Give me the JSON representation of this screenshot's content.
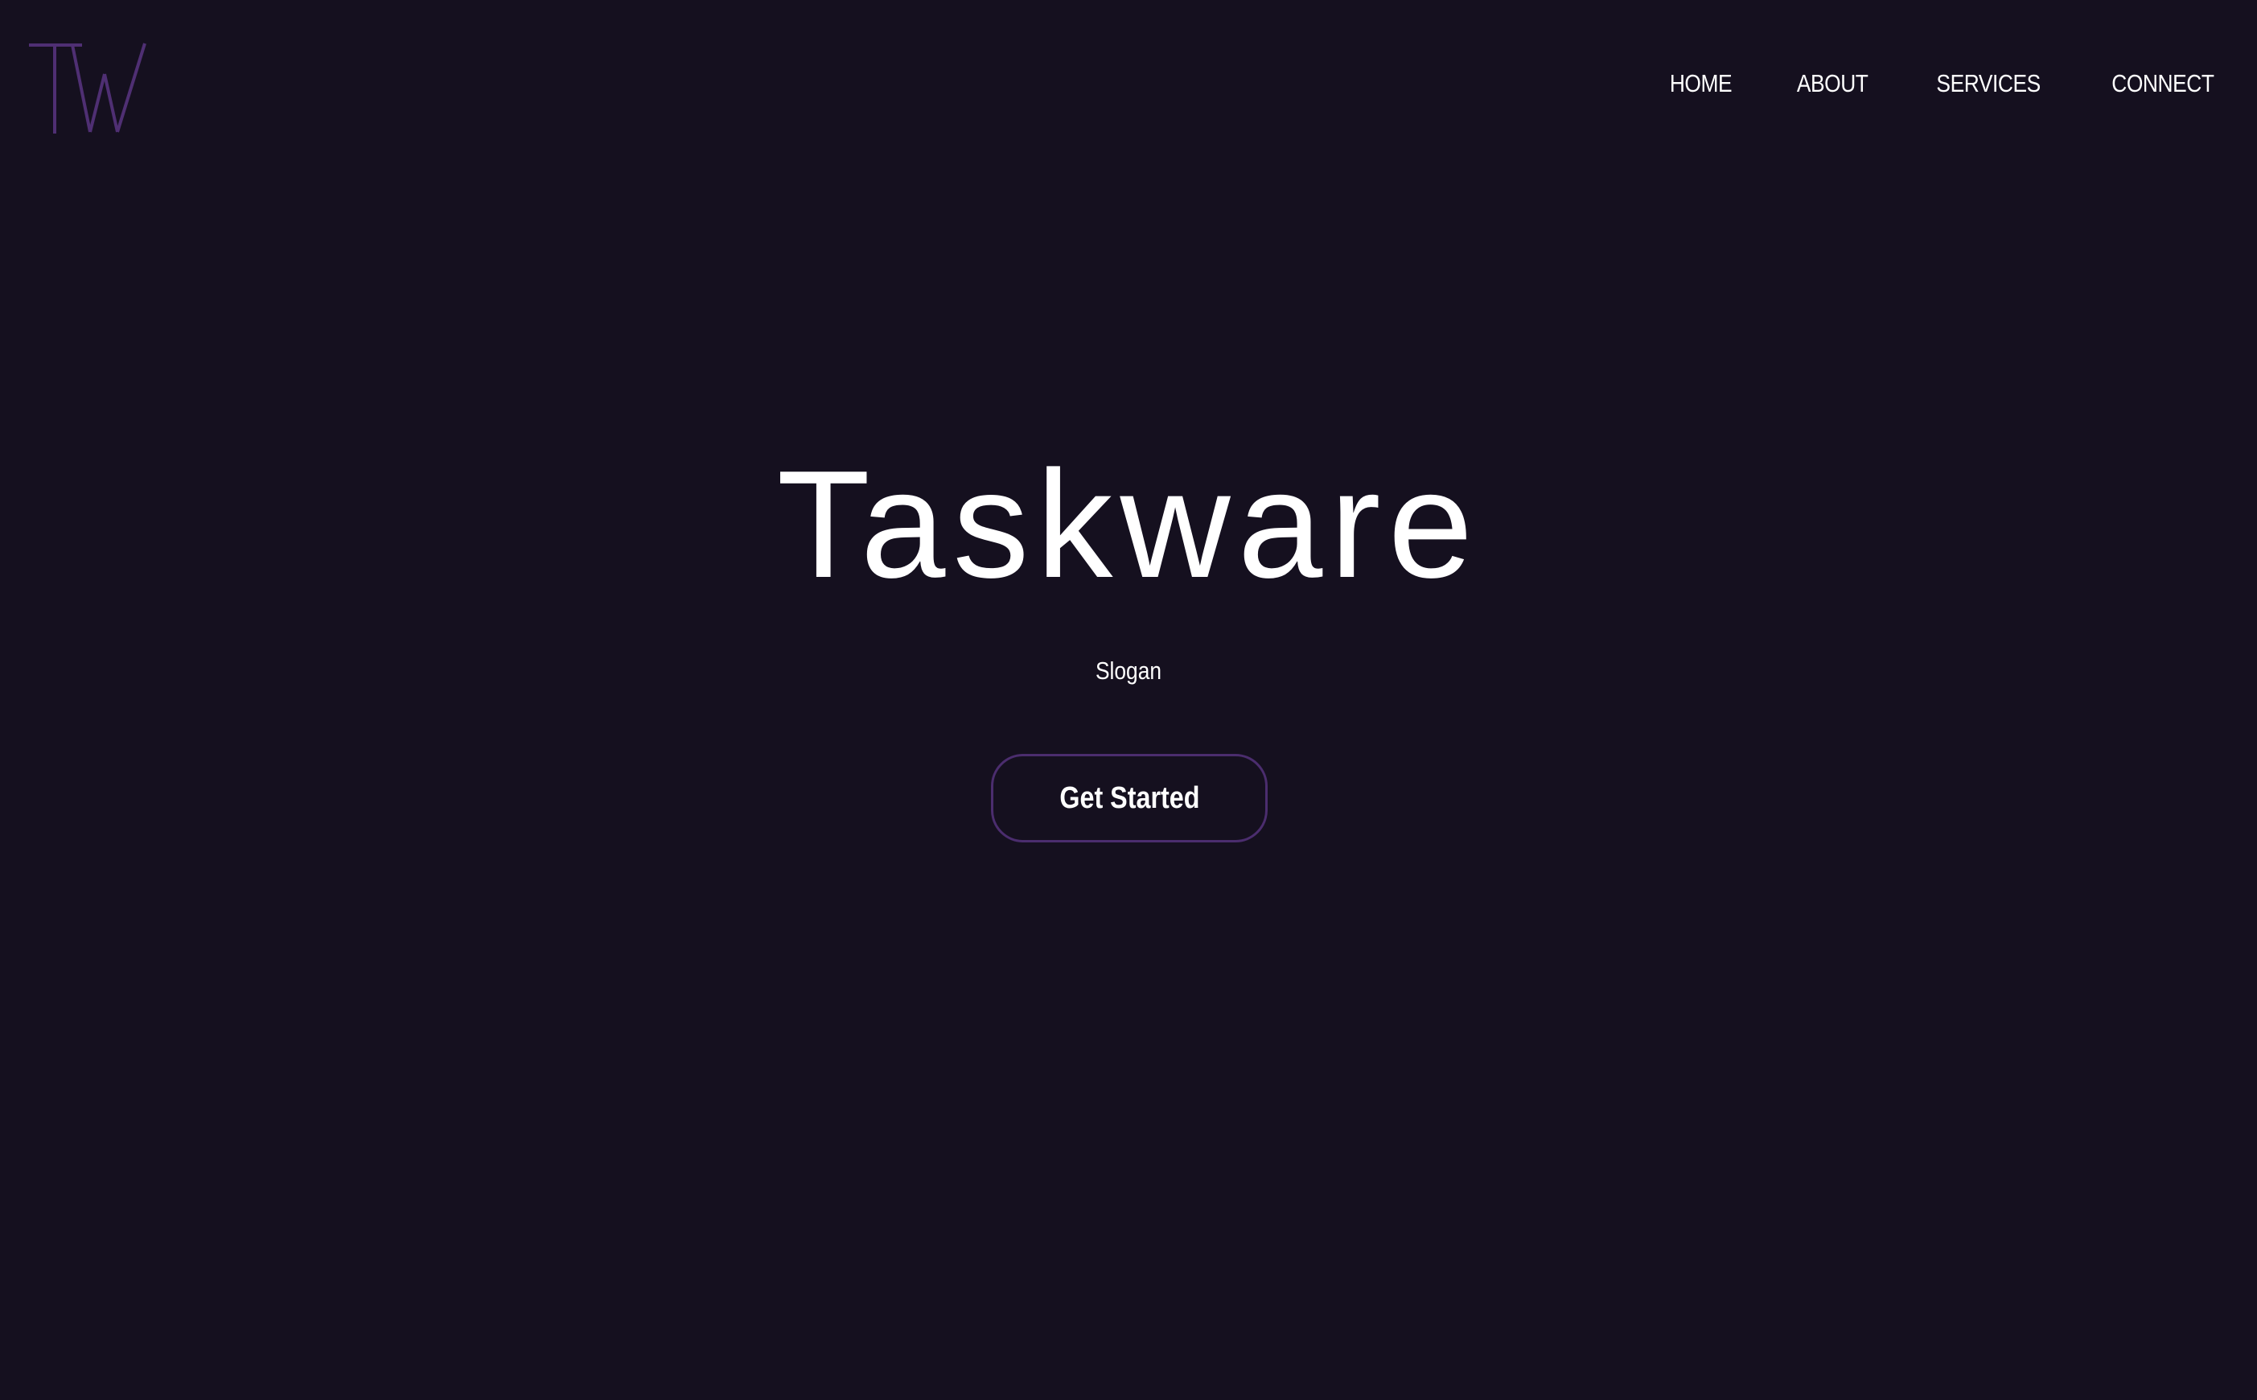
{
  "brand": {
    "logo_text": "TW",
    "logo_color": "#4f2f73"
  },
  "nav": {
    "items": [
      "HOME",
      "ABOUT",
      "SERVICES",
      "CONNECT"
    ]
  },
  "hero": {
    "title": "Taskware",
    "slogan": "Slogan",
    "cta_label": "Get Started"
  },
  "colors": {
    "background": "#15101f",
    "text": "#ffffff",
    "accent": "#4b2d6e"
  }
}
